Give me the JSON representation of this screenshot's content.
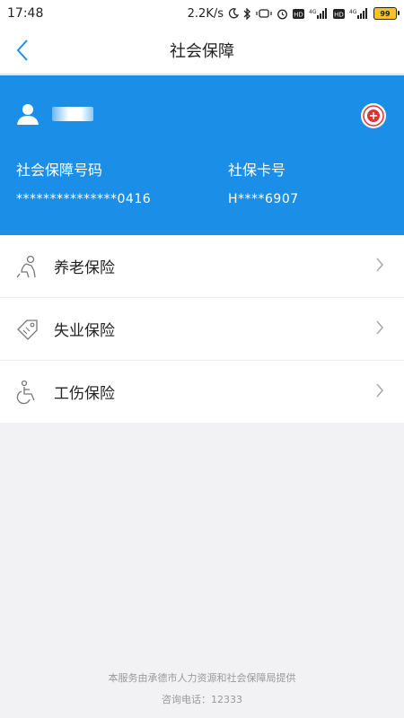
{
  "status_bar": {
    "time": "17:48",
    "net_speed": "2.2K/s",
    "battery": "99",
    "icons": [
      "moon-icon",
      "bluetooth-icon",
      "vibrate-icon",
      "alarm-icon",
      "hd-icon",
      "signal-4g-icon",
      "hd-icon",
      "signal-4g-icon",
      "battery-icon"
    ]
  },
  "nav": {
    "title": "社会保障",
    "back_icon": "chevron-left-icon"
  },
  "card": {
    "user_icon": "user-icon",
    "badge_icon": "emblem-icon",
    "ssn_label": "社会保障号码",
    "ssn_value": "***************0416",
    "card_label": "社保卡号",
    "card_value": "H****6907"
  },
  "items": [
    {
      "label": "养老保险",
      "icon": "elderly-person-icon"
    },
    {
      "label": "失业保险",
      "icon": "tag-icon"
    },
    {
      "label": "工伤保险",
      "icon": "wheelchair-icon"
    }
  ],
  "footer": {
    "provider": "本服务由承德市人力资源和社会保障局提供",
    "hotline": "咨询电话：12333"
  },
  "colors": {
    "accent": "#1b8fe8",
    "background": "#f2f2f4"
  }
}
